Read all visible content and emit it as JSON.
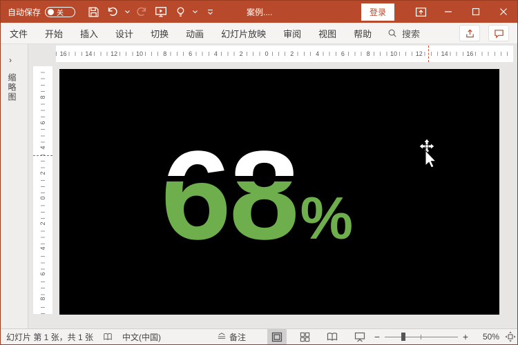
{
  "titlebar": {
    "autosave_label": "自动保存",
    "autosave_state": "关",
    "title": "案例....",
    "signin_label": "登录"
  },
  "ribbon": {
    "tabs": [
      "文件",
      "开始",
      "插入",
      "设计",
      "切换",
      "动画",
      "幻灯片放映",
      "审阅",
      "视图",
      "帮助"
    ],
    "search_label": "搜索"
  },
  "left_pane": {
    "collapse_chevron": "›",
    "thumbnail_label": "缩略图"
  },
  "ruler": {
    "horizontal_labels": [
      "16",
      "14",
      "12",
      "10",
      "8",
      "6",
      "4",
      "2",
      "0",
      "2",
      "4",
      "6",
      "8",
      "10",
      "12",
      "14",
      "16"
    ],
    "vertical_labels": [
      "8",
      "6",
      "4",
      "2",
      "0",
      "2",
      "4",
      "6",
      "8"
    ]
  },
  "slide": {
    "number": "68",
    "percent_sign": "%",
    "colors": {
      "background": "#000000",
      "top_fill": "#ffffff",
      "bottom_fill": "#6fae4c"
    }
  },
  "statusbar": {
    "slide_position": "幻灯片 第 1 张，共 1 张",
    "language": "中文(中国)",
    "notes_label": "备注",
    "zoom_level": "50%"
  },
  "colors": {
    "accent": "#b84a2b"
  }
}
